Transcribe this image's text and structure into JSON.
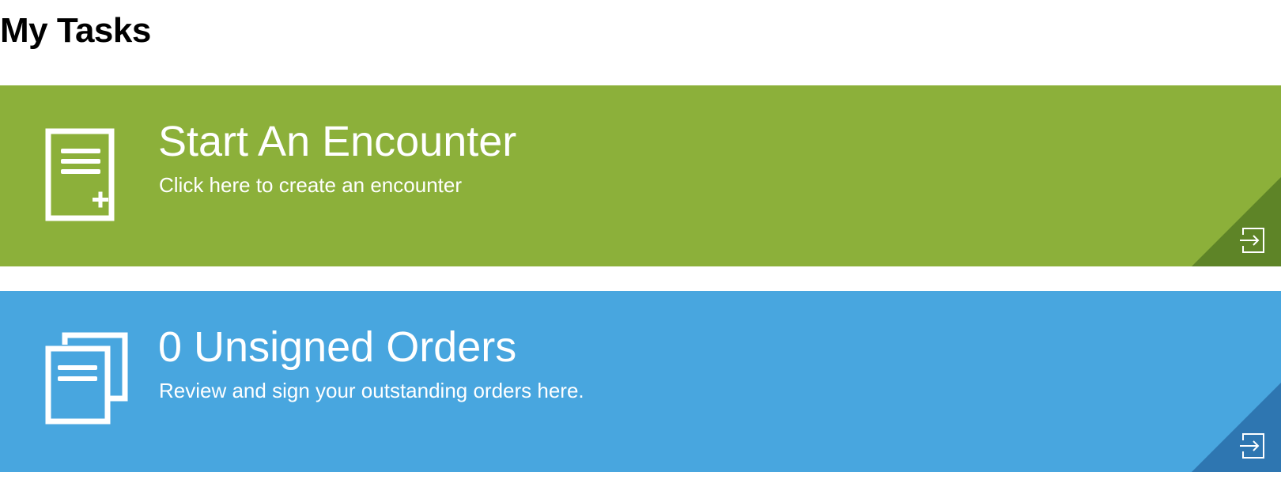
{
  "page": {
    "title": "My Tasks"
  },
  "cards": [
    {
      "title": "Start An Encounter",
      "subtitle": "Click here to create an encounter",
      "icon": "new-document-icon",
      "background": "#8cb03a",
      "corner": "#5e8427"
    },
    {
      "title": "0 Unsigned Orders",
      "subtitle": "Review and sign your outstanding orders here.",
      "icon": "documents-stack-icon",
      "background": "#48a6df",
      "corner": "#2e76b1"
    }
  ]
}
